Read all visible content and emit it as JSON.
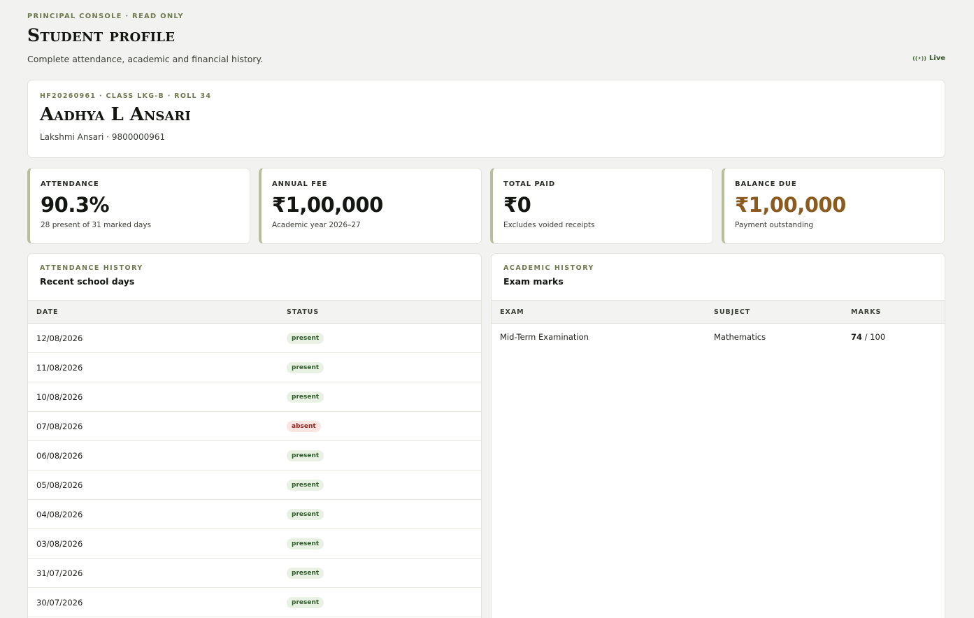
{
  "header": {
    "eyebrow": "PRINCIPAL CONSOLE · READ ONLY",
    "title": "Student profile",
    "subtitle": "Complete attendance, academic and financial history.",
    "live_label": "Live",
    "live_icon": "live-signal-icon"
  },
  "student": {
    "meta": "HF20260961 · CLASS LKG-B · ROLL 34",
    "name": "Aadhya L Ansari",
    "guardian": "Lakshmi Ansari · 9800000961"
  },
  "stats": [
    {
      "label": "ATTENDANCE",
      "value": "90.3%",
      "note": "28 present of 31 marked days"
    },
    {
      "label": "ANNUAL FEE",
      "value": "₹1,00,000",
      "note": "Academic year 2026–27"
    },
    {
      "label": "TOTAL PAID",
      "value": "₹0",
      "note": "Excludes voided receipts"
    },
    {
      "label": "BALANCE DUE",
      "value": "₹1,00,000",
      "note": "Payment outstanding"
    }
  ],
  "colors": {
    "accent": "#b9bf9b",
    "warn": "#8a5a1e",
    "present_bg": "#e9f1e4",
    "absent_bg": "#fbe5e3"
  },
  "attendance": {
    "eyebrow": "ATTENDANCE HISTORY",
    "title": "Recent school days",
    "columns": [
      "DATE",
      "STATUS"
    ],
    "rows": [
      {
        "date": "12/08/2026",
        "status": "present"
      },
      {
        "date": "11/08/2026",
        "status": "present"
      },
      {
        "date": "10/08/2026",
        "status": "present"
      },
      {
        "date": "07/08/2026",
        "status": "absent"
      },
      {
        "date": "06/08/2026",
        "status": "present"
      },
      {
        "date": "05/08/2026",
        "status": "present"
      },
      {
        "date": "04/08/2026",
        "status": "present"
      },
      {
        "date": "03/08/2026",
        "status": "present"
      },
      {
        "date": "31/07/2026",
        "status": "present"
      },
      {
        "date": "30/07/2026",
        "status": "present"
      }
    ]
  },
  "academic": {
    "eyebrow": "ACADEMIC HISTORY",
    "title": "Exam marks",
    "columns": [
      "EXAM",
      "SUBJECT",
      "MARKS"
    ],
    "rows": [
      {
        "exam": "Mid-Term Examination",
        "subject": "Mathematics",
        "marks": "74",
        "max": " / 100"
      }
    ]
  }
}
